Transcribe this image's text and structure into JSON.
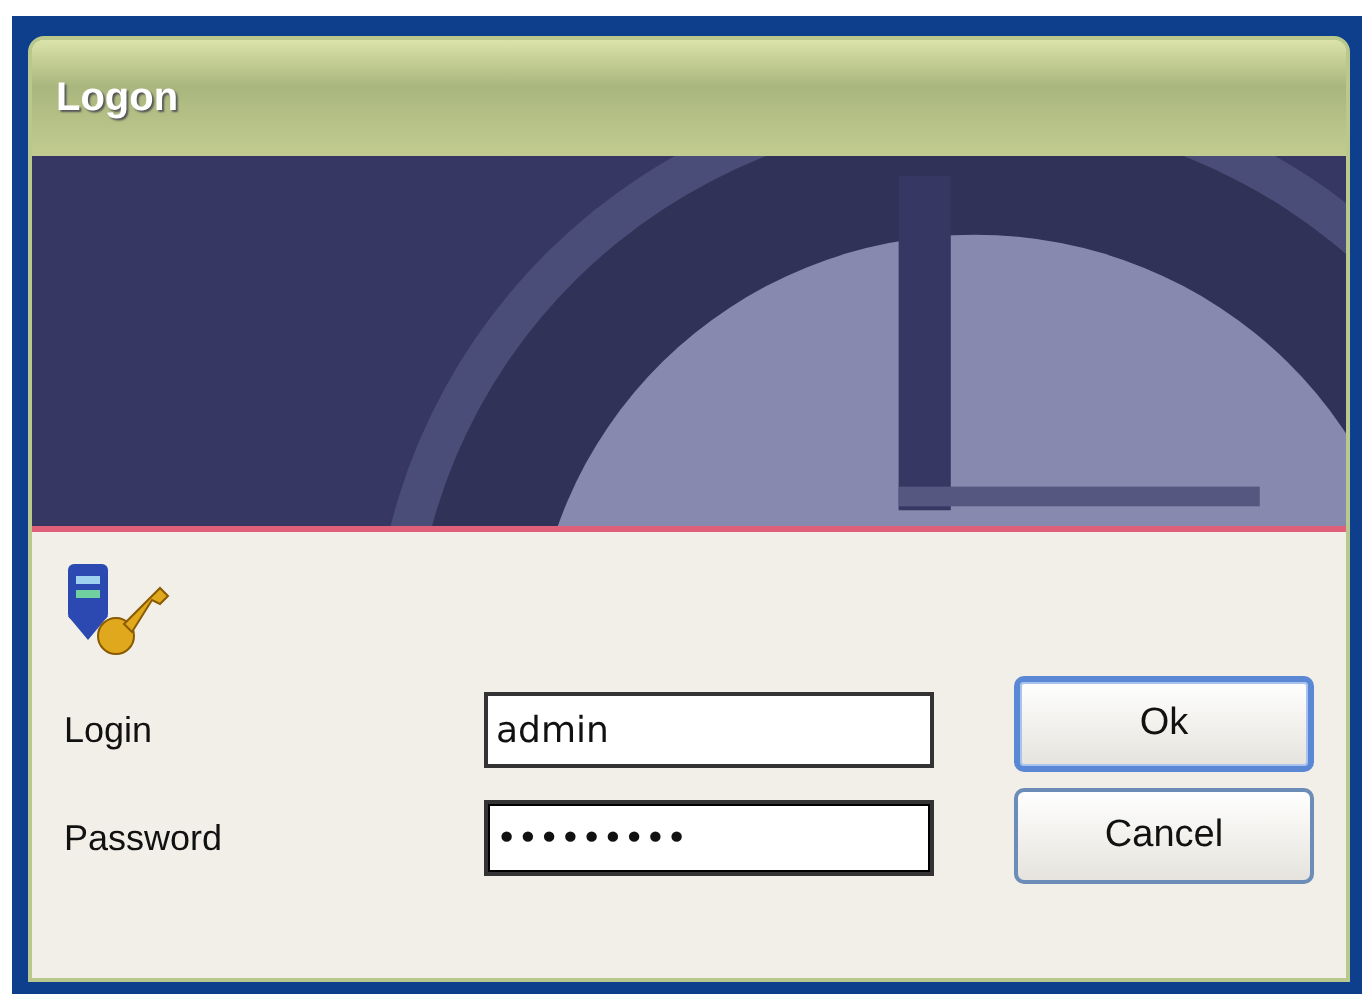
{
  "window": {
    "title": "Logon"
  },
  "fields": [
    {
      "label": "Login",
      "value": "admin",
      "focused": false
    },
    {
      "label": "Password",
      "value": "•••••••••",
      "focused": true
    }
  ],
  "buttons": [
    {
      "label": "Ok",
      "default": true
    },
    {
      "label": "Cancel",
      "default": false
    }
  ]
}
